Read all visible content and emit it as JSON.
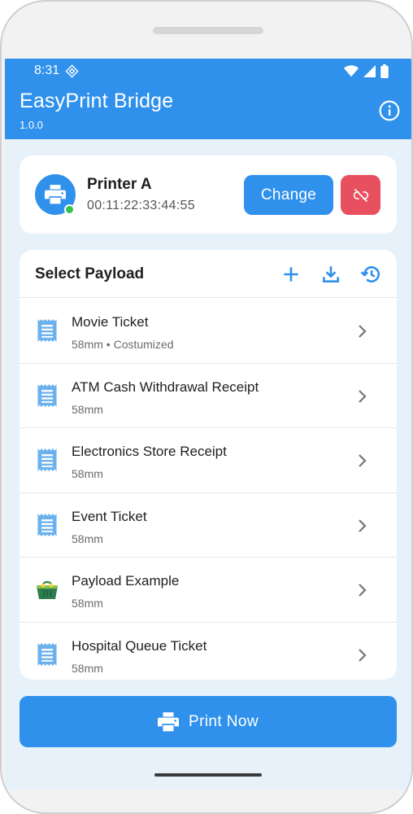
{
  "status_bar": {
    "time": "8:31"
  },
  "app_bar": {
    "title": "EasyPrint Bridge",
    "version": "1.0.0"
  },
  "printer": {
    "name": "Printer A",
    "mac": "00:11:22:33:44:55",
    "connected": true,
    "change_label": "Change"
  },
  "payload_section": {
    "title": "Select Payload",
    "actions": [
      "add-icon",
      "download-icon",
      "history-icon"
    ]
  },
  "payloads": [
    {
      "title": "Movie Ticket",
      "subtitle": "58mm • Costumized",
      "icon": "receipt-icon"
    },
    {
      "title": "ATM Cash Withdrawal Receipt",
      "subtitle": "58mm",
      "icon": "receipt-icon"
    },
    {
      "title": "Electronics Store Receipt",
      "subtitle": "58mm",
      "icon": "receipt-icon"
    },
    {
      "title": "Event Ticket",
      "subtitle": "58mm",
      "icon": "receipt-icon"
    },
    {
      "title": "Payload Example",
      "subtitle": "58mm",
      "icon": "shopping-basket-icon"
    },
    {
      "title": "Hospital Queue Ticket",
      "subtitle": "58mm",
      "icon": "receipt-icon"
    }
  ],
  "print_button": {
    "label": "Print Now"
  },
  "colors": {
    "primary": "#2f91ec",
    "danger": "#e8505f",
    "online": "#34c24a",
    "background": "#e7f1fa"
  }
}
